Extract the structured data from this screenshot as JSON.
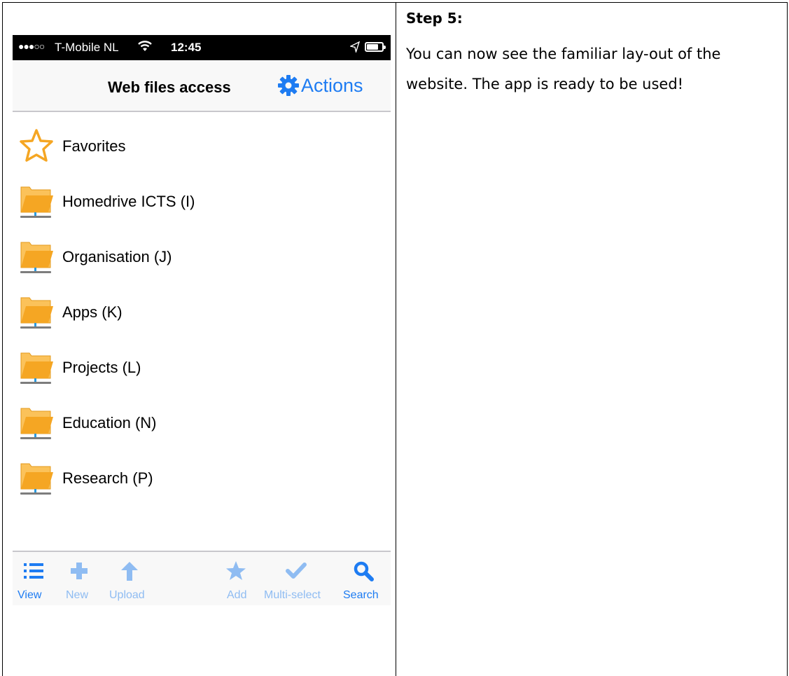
{
  "document": {
    "step_title": "Step 5:",
    "step_text": "You can now see the familiar lay-out of the website. The app is ready to be used!"
  },
  "status_bar": {
    "signal": "●●●○○",
    "carrier": "T-Mobile NL",
    "time": "12:45",
    "battery_level": 0.75
  },
  "nav_bar": {
    "title": "Web files access",
    "actions_label": "Actions"
  },
  "list": {
    "items": [
      {
        "label": "Favorites",
        "icon": "star-icon"
      },
      {
        "label": "Homedrive ICTS (I)",
        "icon": "network-folder-icon"
      },
      {
        "label": "Organisation (J)",
        "icon": "network-folder-icon"
      },
      {
        "label": "Apps (K)",
        "icon": "network-folder-icon"
      },
      {
        "label": "Projects (L)",
        "icon": "network-folder-icon"
      },
      {
        "label": "Education (N)",
        "icon": "network-folder-icon"
      },
      {
        "label": "Research (P)",
        "icon": "network-folder-icon"
      }
    ]
  },
  "tab_bar": {
    "view": "View",
    "new": "New",
    "upload": "Upload",
    "add": "Add",
    "multi_select": "Multi-select",
    "search": "Search"
  },
  "colors": {
    "accent": "#1e7cf2",
    "accent_dim": "#8fbcf2",
    "folder": "#f5a623",
    "status_bar": "#000000"
  }
}
